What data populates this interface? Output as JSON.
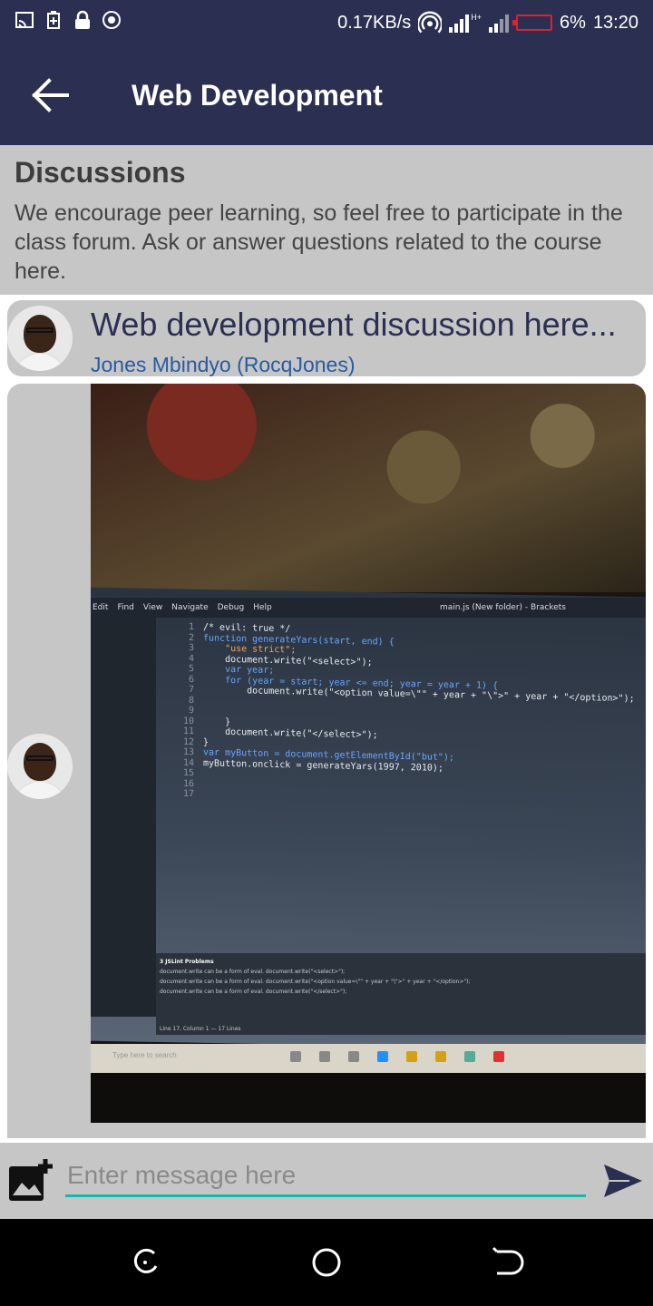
{
  "status_bar": {
    "speed": "0.17KB/s",
    "network": "H+",
    "battery": "6%",
    "time": "13:20"
  },
  "app_bar": {
    "title": "Web Development"
  },
  "intro": {
    "heading": "Discussions",
    "text": "We encourage peer learning, so feel free to participate in the class forum. Ask or answer questions related to the course here."
  },
  "thread": {
    "topic": "Web development discussion here...",
    "author": "Jones Mbindyo (RocqJones)"
  },
  "photo": {
    "menu": [
      "Edit",
      "Find",
      "View",
      "Navigate",
      "Debug",
      "Help"
    ],
    "file_title": "main.js (New folder) - Brackets",
    "code_lines": [
      {
        "n": "1",
        "t": "/* evil: true */"
      },
      {
        "n": "2",
        "t": "function generateYars(start, end) {"
      },
      {
        "n": "3",
        "t": "    \"use strict\";"
      },
      {
        "n": "4",
        "t": "    document.write(\"<select>\");"
      },
      {
        "n": "5",
        "t": "    var year;"
      },
      {
        "n": "6",
        "t": "    for (year = start; year <= end; year = year + 1) {"
      },
      {
        "n": "7",
        "t": "        document.write(\"<option value=\\\"\" + year + \"\\\">\" + year + \"</option>\");"
      },
      {
        "n": "8",
        "t": ""
      },
      {
        "n": "9",
        "t": ""
      },
      {
        "n": "10",
        "t": "    }"
      },
      {
        "n": "11",
        "t": "    document.write(\"</select>\");"
      },
      {
        "n": "12",
        "t": "}"
      },
      {
        "n": "13",
        "t": "var myButton = document.getElementById(\"but\");"
      },
      {
        "n": "14",
        "t": "myButton.onclick = generateYars(1997, 2010);"
      },
      {
        "n": "15",
        "t": ""
      },
      {
        "n": "16",
        "t": ""
      },
      {
        "n": "17",
        "t": ""
      }
    ],
    "problems_title": "3 JSLint Problems",
    "problems": [
      "document.write can be a form of eval.   document.write(\"<select>\");",
      "document.write can be a form of eval.   document.write(\"<option value=\\\"\" + year + \"\\\">\" + year + \"</option>\");",
      "document.write can be a form of eval.   document.write(\"</select>\");"
    ],
    "status_line": "Line 17, Column 1 — 17 Lines",
    "search_placeholder": "Type here to search"
  },
  "composer": {
    "placeholder": "Enter message here"
  },
  "icons": {
    "back": "arrow-left-icon",
    "attach": "add-photo-icon",
    "send": "send-icon"
  },
  "colors": {
    "app_bar": "#2b2f52",
    "card": "#c6c6c6",
    "author": "#2a5aa0",
    "input_underline": "#17b8a8"
  }
}
